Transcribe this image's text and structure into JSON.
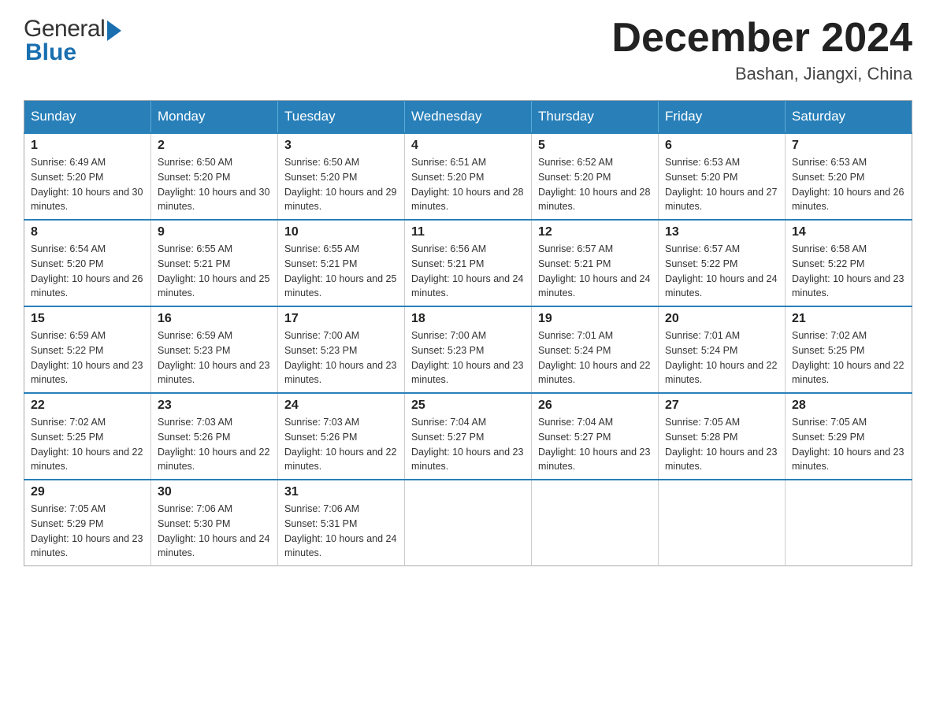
{
  "header": {
    "logo_general": "General",
    "logo_blue": "Blue",
    "month_title": "December 2024",
    "location": "Bashan, Jiangxi, China"
  },
  "days_of_week": [
    "Sunday",
    "Monday",
    "Tuesday",
    "Wednesday",
    "Thursday",
    "Friday",
    "Saturday"
  ],
  "weeks": [
    [
      {
        "day": "1",
        "sunrise": "6:49 AM",
        "sunset": "5:20 PM",
        "daylight": "10 hours and 30 minutes."
      },
      {
        "day": "2",
        "sunrise": "6:50 AM",
        "sunset": "5:20 PM",
        "daylight": "10 hours and 30 minutes."
      },
      {
        "day": "3",
        "sunrise": "6:50 AM",
        "sunset": "5:20 PM",
        "daylight": "10 hours and 29 minutes."
      },
      {
        "day": "4",
        "sunrise": "6:51 AM",
        "sunset": "5:20 PM",
        "daylight": "10 hours and 28 minutes."
      },
      {
        "day": "5",
        "sunrise": "6:52 AM",
        "sunset": "5:20 PM",
        "daylight": "10 hours and 28 minutes."
      },
      {
        "day": "6",
        "sunrise": "6:53 AM",
        "sunset": "5:20 PM",
        "daylight": "10 hours and 27 minutes."
      },
      {
        "day": "7",
        "sunrise": "6:53 AM",
        "sunset": "5:20 PM",
        "daylight": "10 hours and 26 minutes."
      }
    ],
    [
      {
        "day": "8",
        "sunrise": "6:54 AM",
        "sunset": "5:20 PM",
        "daylight": "10 hours and 26 minutes."
      },
      {
        "day": "9",
        "sunrise": "6:55 AM",
        "sunset": "5:21 PM",
        "daylight": "10 hours and 25 minutes."
      },
      {
        "day": "10",
        "sunrise": "6:55 AM",
        "sunset": "5:21 PM",
        "daylight": "10 hours and 25 minutes."
      },
      {
        "day": "11",
        "sunrise": "6:56 AM",
        "sunset": "5:21 PM",
        "daylight": "10 hours and 24 minutes."
      },
      {
        "day": "12",
        "sunrise": "6:57 AM",
        "sunset": "5:21 PM",
        "daylight": "10 hours and 24 minutes."
      },
      {
        "day": "13",
        "sunrise": "6:57 AM",
        "sunset": "5:22 PM",
        "daylight": "10 hours and 24 minutes."
      },
      {
        "day": "14",
        "sunrise": "6:58 AM",
        "sunset": "5:22 PM",
        "daylight": "10 hours and 23 minutes."
      }
    ],
    [
      {
        "day": "15",
        "sunrise": "6:59 AM",
        "sunset": "5:22 PM",
        "daylight": "10 hours and 23 minutes."
      },
      {
        "day": "16",
        "sunrise": "6:59 AM",
        "sunset": "5:23 PM",
        "daylight": "10 hours and 23 minutes."
      },
      {
        "day": "17",
        "sunrise": "7:00 AM",
        "sunset": "5:23 PM",
        "daylight": "10 hours and 23 minutes."
      },
      {
        "day": "18",
        "sunrise": "7:00 AM",
        "sunset": "5:23 PM",
        "daylight": "10 hours and 23 minutes."
      },
      {
        "day": "19",
        "sunrise": "7:01 AM",
        "sunset": "5:24 PM",
        "daylight": "10 hours and 22 minutes."
      },
      {
        "day": "20",
        "sunrise": "7:01 AM",
        "sunset": "5:24 PM",
        "daylight": "10 hours and 22 minutes."
      },
      {
        "day": "21",
        "sunrise": "7:02 AM",
        "sunset": "5:25 PM",
        "daylight": "10 hours and 22 minutes."
      }
    ],
    [
      {
        "day": "22",
        "sunrise": "7:02 AM",
        "sunset": "5:25 PM",
        "daylight": "10 hours and 22 minutes."
      },
      {
        "day": "23",
        "sunrise": "7:03 AM",
        "sunset": "5:26 PM",
        "daylight": "10 hours and 22 minutes."
      },
      {
        "day": "24",
        "sunrise": "7:03 AM",
        "sunset": "5:26 PM",
        "daylight": "10 hours and 22 minutes."
      },
      {
        "day": "25",
        "sunrise": "7:04 AM",
        "sunset": "5:27 PM",
        "daylight": "10 hours and 23 minutes."
      },
      {
        "day": "26",
        "sunrise": "7:04 AM",
        "sunset": "5:27 PM",
        "daylight": "10 hours and 23 minutes."
      },
      {
        "day": "27",
        "sunrise": "7:05 AM",
        "sunset": "5:28 PM",
        "daylight": "10 hours and 23 minutes."
      },
      {
        "day": "28",
        "sunrise": "7:05 AM",
        "sunset": "5:29 PM",
        "daylight": "10 hours and 23 minutes."
      }
    ],
    [
      {
        "day": "29",
        "sunrise": "7:05 AM",
        "sunset": "5:29 PM",
        "daylight": "10 hours and 23 minutes."
      },
      {
        "day": "30",
        "sunrise": "7:06 AM",
        "sunset": "5:30 PM",
        "daylight": "10 hours and 24 minutes."
      },
      {
        "day": "31",
        "sunrise": "7:06 AM",
        "sunset": "5:31 PM",
        "daylight": "10 hours and 24 minutes."
      },
      null,
      null,
      null,
      null
    ]
  ],
  "labels": {
    "sunrise_prefix": "Sunrise: ",
    "sunset_prefix": "Sunset: ",
    "daylight_prefix": "Daylight: "
  }
}
